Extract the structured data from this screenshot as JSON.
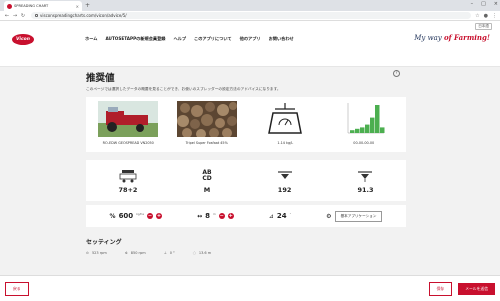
{
  "browser": {
    "tab_title": "SPREADING CHART",
    "new_tab": "+",
    "url": "visconspreadingcharts.com/vicon/advice/5/",
    "nav_back": "←",
    "nav_forward": "→",
    "nav_reload": "↻"
  },
  "header": {
    "language": "日本語",
    "logo_text": "Vicon",
    "menu": [
      "ホーム",
      "AUTOSETAPPの新規会員登録",
      "ヘルプ",
      "このアプリについて",
      "他のアプリ",
      "お問い合わせ"
    ],
    "slogan_prefix": "My way ",
    "slogan_brand": "of Farming!"
  },
  "page": {
    "title": "推奨値",
    "help_icon": "?",
    "description": "このページでは選択したデータの概要を見ることができ、お使いのスプレッダーの設定方法のアドバイスになります。"
  },
  "products": [
    {
      "name": "machine",
      "caption": "RO-EDW GEOSPREAD VN2050"
    },
    {
      "name": "fertilizer",
      "caption": "Tripel Super Fosfaat 45%"
    },
    {
      "name": "weight",
      "caption": "1.14 kg/L"
    },
    {
      "name": "chart",
      "caption": "00-00-00-00"
    }
  ],
  "chart_bars": [
    0.1,
    0.15,
    0.2,
    0.3,
    0.55,
    1.0,
    0.2
  ],
  "settings": [
    {
      "icon": "spreader-disc-icon",
      "value": "78+2"
    },
    {
      "icon": "vane-type-icon",
      "value": "M",
      "text_top": "AB",
      "text_bottom": "CD"
    },
    {
      "icon": "shutter-icon",
      "value": "192"
    },
    {
      "icon": "tilt-icon",
      "value": "91.3"
    }
  ],
  "controls": {
    "rate_value": "600",
    "rate_unit": "kg/ha",
    "width_value": "8",
    "width_unit": "m",
    "angle_value": "24",
    "angle_unit": "°",
    "minus": "−",
    "plus": "+",
    "application_button": "基本アプリケーション"
  },
  "settings_section": {
    "title": "セッティング",
    "items": [
      "523 rpm",
      "850 rpm",
      "0 °",
      "13.6 m"
    ]
  },
  "footer": {
    "back": "戻る",
    "save": "保存",
    "send_email": "メールを送信"
  },
  "colors": {
    "accent": "#c8102e",
    "chart_green": "#4caf50"
  }
}
